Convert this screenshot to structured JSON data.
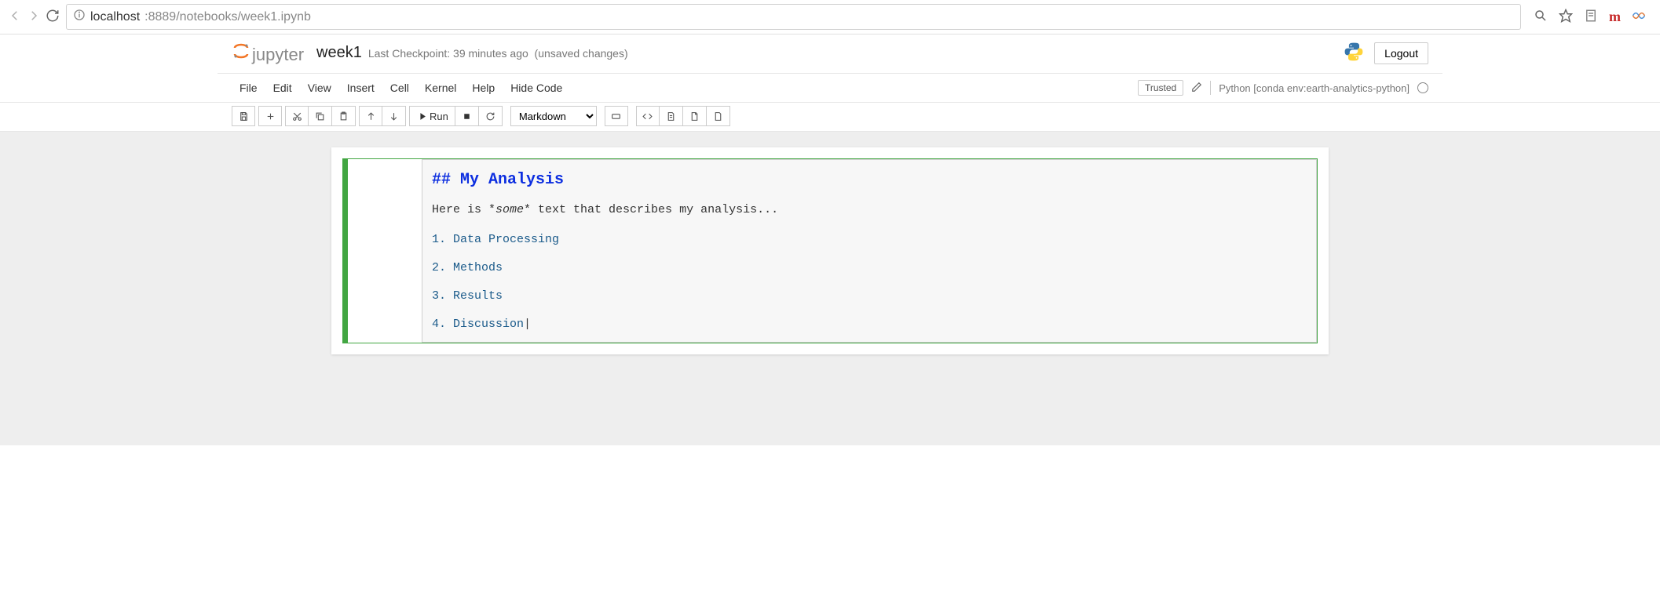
{
  "browser": {
    "url_host": "localhost",
    "url_path": ":8889/notebooks/week1.ipynb",
    "m_label": "m"
  },
  "header": {
    "logo_text": "jupyter",
    "notebook_name": "week1",
    "checkpoint": "Last Checkpoint: 39 minutes ago",
    "unsaved": "(unsaved changes)",
    "logout": "Logout"
  },
  "menu": {
    "items": [
      "File",
      "Edit",
      "View",
      "Insert",
      "Cell",
      "Kernel",
      "Help",
      "Hide Code"
    ],
    "trusted": "Trusted",
    "kernel": "Python [conda env:earth-analytics-python]"
  },
  "toolbar": {
    "run_label": "Run",
    "cell_type": "Markdown"
  },
  "cell": {
    "heading": "## My Analysis",
    "body_pre": "Here is *",
    "body_em": "some",
    "body_post": "* text that describes my analysis...",
    "list": [
      "1. Data Processing",
      "2. Methods",
      "3. Results",
      "4. Discussion"
    ],
    "cursor": " |"
  }
}
